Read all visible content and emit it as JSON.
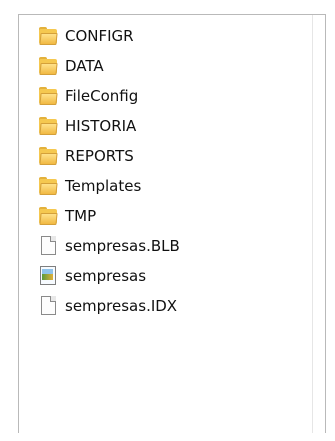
{
  "items": [
    {
      "label": "CONFIGR",
      "icon": "folder-icon"
    },
    {
      "label": "DATA",
      "icon": "folder-icon"
    },
    {
      "label": "FileConfig",
      "icon": "folder-icon"
    },
    {
      "label": "HISTORIA",
      "icon": "folder-icon"
    },
    {
      "label": "REPORTS",
      "icon": "folder-icon"
    },
    {
      "label": "Templates",
      "icon": "folder-icon"
    },
    {
      "label": "TMP",
      "icon": "folder-icon"
    },
    {
      "label": "sempresas.BLB",
      "icon": "file-icon"
    },
    {
      "label": "sempresas",
      "icon": "data-file-icon"
    },
    {
      "label": "sempresas.IDX",
      "icon": "file-icon"
    }
  ]
}
